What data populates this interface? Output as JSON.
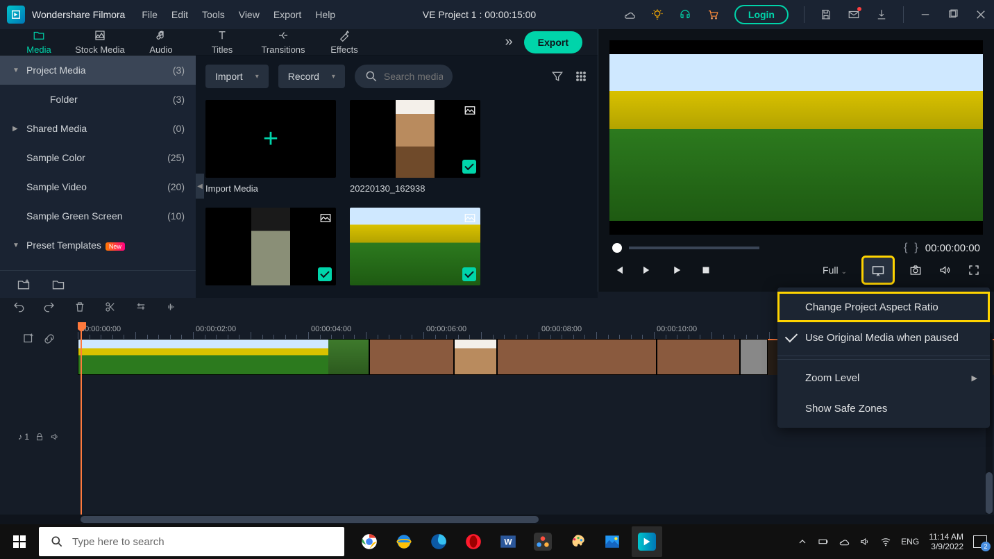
{
  "app": {
    "name": "Wondershare Filmora"
  },
  "menus": {
    "file": "File",
    "edit": "Edit",
    "tools": "Tools",
    "view": "View",
    "export": "Export",
    "help": "Help"
  },
  "project": {
    "title": "VE Project 1 : 00:00:15:00"
  },
  "login_label": "Login",
  "tabs": {
    "media": "Media",
    "stock": "Stock Media",
    "audio": "Audio",
    "titles": "Titles",
    "transitions": "Transitions",
    "effects": "Effects"
  },
  "export_btn": "Export",
  "sidebar": {
    "items": [
      {
        "label": "Project Media",
        "count": "(3)",
        "caret": "▼",
        "sel": true
      },
      {
        "label": "Folder",
        "count": "(3)",
        "indent": true
      },
      {
        "label": "Shared Media",
        "count": "(0)",
        "caret": "▶"
      },
      {
        "label": "Sample Color",
        "count": "(25)"
      },
      {
        "label": "Sample Video",
        "count": "(20)"
      },
      {
        "label": "Sample Green Screen",
        "count": "(10)"
      },
      {
        "label": "Preset Templates",
        "count": "",
        "caret": "▼",
        "new": true
      }
    ]
  },
  "media_toolbar": {
    "import": "Import",
    "record": "Record",
    "search_placeholder": "Search media"
  },
  "media_cards": [
    {
      "name": "Import Media",
      "type": "import"
    },
    {
      "name": "20220130_162938",
      "type": "portrait",
      "check": true
    },
    {
      "name": "",
      "type": "hood",
      "check": true
    },
    {
      "name": "",
      "type": "field",
      "check": true
    }
  ],
  "preview": {
    "scrub_time": "00:00:00:00",
    "quality": "Full"
  },
  "popup": {
    "items": [
      {
        "label": "Change Project Aspect Ratio",
        "hl": true
      },
      {
        "label": "Use Original Media when paused",
        "check": true
      },
      {
        "label": "Zoom Level",
        "arrow": true
      },
      {
        "label": "Show Safe Zones"
      }
    ]
  },
  "timeline": {
    "ticks": [
      "00:00:00:00",
      "00:00:02:00",
      "00:00:04:00",
      "00:00:06:00",
      "00:00:08:00",
      "00:00:10:00"
    ],
    "audio_track_label": "♪ 1"
  },
  "taskbar": {
    "search_placeholder": "Type here to search",
    "lang": "ENG",
    "time": "11:14 AM",
    "date": "3/9/2022",
    "notif_count": "2"
  }
}
